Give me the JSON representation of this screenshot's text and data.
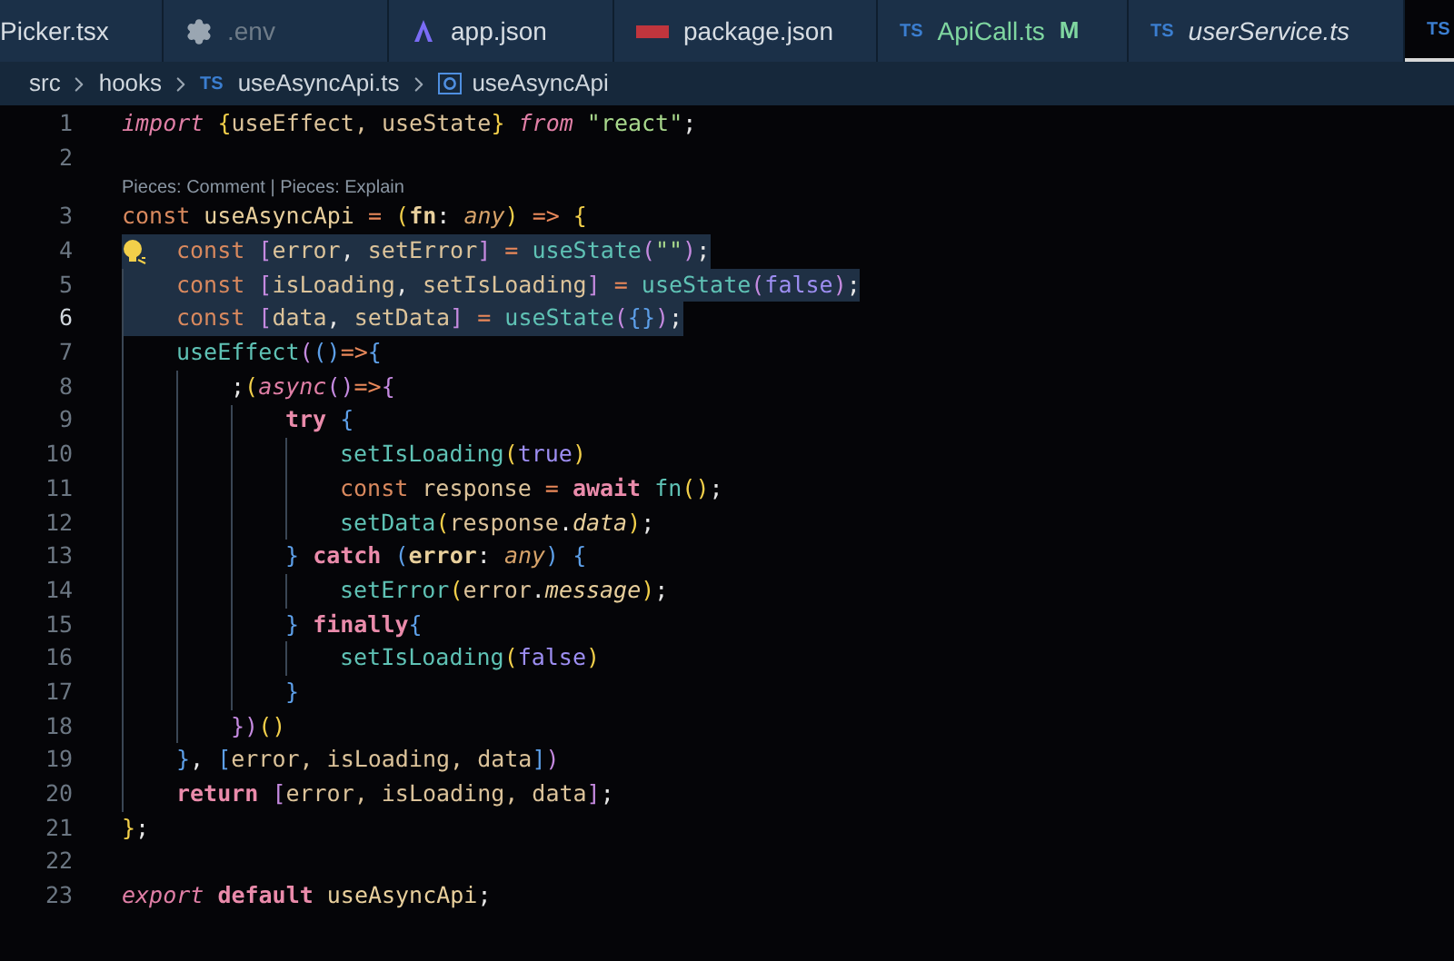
{
  "tabs": [
    {
      "label": "Picker.tsx",
      "kind": "plain",
      "selected": false,
      "italic": false,
      "dimmed": false
    },
    {
      "label": ".env",
      "kind": "config",
      "selected": false,
      "italic": false,
      "dimmed": true
    },
    {
      "label": "app.json",
      "kind": "app",
      "selected": false,
      "italic": false,
      "dimmed": false
    },
    {
      "label": "package.json",
      "kind": "npm",
      "selected": false,
      "italic": false,
      "dimmed": false
    },
    {
      "label": "ApiCall.ts",
      "kind": "ts",
      "badge": "TS",
      "selected": false,
      "italic": false,
      "dimmed": false,
      "modified": "M"
    },
    {
      "label": "userService.ts",
      "kind": "ts",
      "badge": "TS",
      "selected": false,
      "italic": true,
      "dimmed": false
    },
    {
      "kind": "ts",
      "badge": "TS",
      "selected": true
    }
  ],
  "breadcrumb": [
    {
      "kind": "folder",
      "label": "src"
    },
    {
      "kind": "folder",
      "label": "hooks"
    },
    {
      "kind": "file",
      "badge": "TS",
      "label": "useAsyncApi.ts"
    },
    {
      "kind": "symbol",
      "label": "useAsyncApi"
    }
  ],
  "lines": [
    {
      "number": "1",
      "selected": false,
      "active": false,
      "tokens": [
        {
          "kind": "kwi",
          "text": "import "
        },
        {
          "kind": "b1",
          "text": "{"
        },
        {
          "kind": "var",
          "text": "useEffect, useState"
        },
        {
          "kind": "b1",
          "text": "} "
        },
        {
          "kind": "kwi",
          "text": "from "
        },
        {
          "kind": "str",
          "text": "\"react\""
        },
        {
          "kind": "p",
          "text": ";"
        }
      ]
    },
    {
      "number": "2",
      "active": false
    },
    {
      "number": "3",
      "selected": false,
      "active": false,
      "codelens": "Pieces: Comment | Pieces: Explain",
      "tokens": [
        {
          "kind": "sto",
          "text": "const "
        },
        {
          "kind": "name",
          "text": "useAsyncApi "
        },
        {
          "kind": "op",
          "text": "= "
        },
        {
          "kind": "b1",
          "text": "("
        },
        {
          "kind": "param",
          "text": "fn"
        },
        {
          "kind": "p",
          "text": ": "
        },
        {
          "kind": "type",
          "text": "any"
        },
        {
          "kind": "b1",
          "text": ") "
        },
        {
          "kind": "op",
          "text": "=> "
        },
        {
          "kind": "b1",
          "text": "{"
        }
      ],
      "children": [
        {
          "number": "4",
          "selected": true,
          "active": false,
          "lightbulb": true,
          "tokens": [
            {
              "kind": "sto",
              "text": "const "
            },
            {
              "kind": "b2",
              "text": "["
            },
            {
              "kind": "var",
              "text": "error"
            },
            {
              "kind": "p",
              "text": ", "
            },
            {
              "kind": "var",
              "text": "setError"
            },
            {
              "kind": "b2",
              "text": "] "
            },
            {
              "kind": "op",
              "text": "= "
            },
            {
              "kind": "fn",
              "text": "useState"
            },
            {
              "kind": "b2",
              "text": "("
            },
            {
              "kind": "str",
              "text": "\"\""
            },
            {
              "kind": "b2",
              "text": ")"
            },
            {
              "kind": "p",
              "text": ";"
            }
          ]
        },
        {
          "number": "5",
          "selected": true,
          "active": false,
          "tokens": [
            {
              "kind": "sto",
              "text": "const "
            },
            {
              "kind": "b2",
              "text": "["
            },
            {
              "kind": "var",
              "text": "isLoading"
            },
            {
              "kind": "p",
              "text": ", "
            },
            {
              "kind": "var",
              "text": "setIsLoading"
            },
            {
              "kind": "b2",
              "text": "] "
            },
            {
              "kind": "op",
              "text": "= "
            },
            {
              "kind": "fn",
              "text": "useState"
            },
            {
              "kind": "b2",
              "text": "("
            },
            {
              "kind": "bool",
              "text": "false"
            },
            {
              "kind": "b2",
              "text": ")"
            },
            {
              "kind": "p",
              "text": ";"
            }
          ]
        },
        {
          "number": "6",
          "selected": true,
          "active": true,
          "tokens": [
            {
              "kind": "sto",
              "text": "const "
            },
            {
              "kind": "b2",
              "text": "["
            },
            {
              "kind": "var",
              "text": "data"
            },
            {
              "kind": "p",
              "text": ", "
            },
            {
              "kind": "var",
              "text": "setData"
            },
            {
              "kind": "b2",
              "text": "] "
            },
            {
              "kind": "op",
              "text": "= "
            },
            {
              "kind": "fn",
              "text": "useState"
            },
            {
              "kind": "b2",
              "text": "("
            },
            {
              "kind": "b3",
              "text": "{}"
            },
            {
              "kind": "b2",
              "text": ")"
            },
            {
              "kind": "p",
              "text": ";"
            }
          ]
        },
        {
          "number": "7",
          "selected": false,
          "active": false,
          "tokens": [
            {
              "kind": "fn",
              "text": "useEffect"
            },
            {
              "kind": "b2",
              "text": "("
            },
            {
              "kind": "b3",
              "text": "()"
            },
            {
              "kind": "op",
              "text": "=>"
            },
            {
              "kind": "b3",
              "text": "{"
            }
          ],
          "children": [
            {
              "number": "8",
              "selected": false,
              "active": false,
              "tokens": [
                {
                  "kind": "p",
                  "text": ";"
                },
                {
                  "kind": "b1",
                  "text": "("
                },
                {
                  "kind": "kwi",
                  "text": "async"
                },
                {
                  "kind": "b2",
                  "text": "()"
                },
                {
                  "kind": "op",
                  "text": "=>"
                },
                {
                  "kind": "b2",
                  "text": "{"
                }
              ],
              "children": [
                {
                  "number": "9",
                  "selected": false,
                  "active": false,
                  "tokens": [
                    {
                      "kind": "ctrl",
                      "text": "try "
                    },
                    {
                      "kind": "b3",
                      "text": "{"
                    }
                  ],
                  "children": [
                    {
                      "number": "10",
                      "selected": false,
                      "active": false,
                      "tokens": [
                        {
                          "kind": "fn",
                          "text": "setIsLoading"
                        },
                        {
                          "kind": "b1",
                          "text": "("
                        },
                        {
                          "kind": "bool",
                          "text": "true"
                        },
                        {
                          "kind": "b1",
                          "text": ")"
                        }
                      ]
                    },
                    {
                      "number": "11",
                      "selected": false,
                      "active": false,
                      "tokens": [
                        {
                          "kind": "sto",
                          "text": "const "
                        },
                        {
                          "kind": "var",
                          "text": "response "
                        },
                        {
                          "kind": "op",
                          "text": "= "
                        },
                        {
                          "kind": "ctrl",
                          "text": "await "
                        },
                        {
                          "kind": "fn",
                          "text": "fn"
                        },
                        {
                          "kind": "b1",
                          "text": "()"
                        },
                        {
                          "kind": "p",
                          "text": ";"
                        }
                      ]
                    },
                    {
                      "number": "12",
                      "selected": false,
                      "active": false,
                      "tokens": [
                        {
                          "kind": "fn",
                          "text": "setData"
                        },
                        {
                          "kind": "b1",
                          "text": "("
                        },
                        {
                          "kind": "var",
                          "text": "response"
                        },
                        {
                          "kind": "p",
                          "text": "."
                        },
                        {
                          "kind": "prop",
                          "text": "data"
                        },
                        {
                          "kind": "b1",
                          "text": ")"
                        },
                        {
                          "kind": "p",
                          "text": ";"
                        }
                      ]
                    }
                  ]
                },
                {
                  "number": "13",
                  "selected": false,
                  "active": false,
                  "tokens": [
                    {
                      "kind": "b3",
                      "text": "} "
                    },
                    {
                      "kind": "ctrl",
                      "text": "catch "
                    },
                    {
                      "kind": "b3",
                      "text": "("
                    },
                    {
                      "kind": "param",
                      "text": "error"
                    },
                    {
                      "kind": "p",
                      "text": ": "
                    },
                    {
                      "kind": "type",
                      "text": "any"
                    },
                    {
                      "kind": "b3",
                      "text": ") {"
                    }
                  ],
                  "children": [
                    {
                      "number": "14",
                      "selected": false,
                      "active": false,
                      "tokens": [
                        {
                          "kind": "fn",
                          "text": "setError"
                        },
                        {
                          "kind": "b1",
                          "text": "("
                        },
                        {
                          "kind": "var",
                          "text": "error"
                        },
                        {
                          "kind": "p",
                          "text": "."
                        },
                        {
                          "kind": "prop",
                          "text": "message"
                        },
                        {
                          "kind": "b1",
                          "text": ")"
                        },
                        {
                          "kind": "p",
                          "text": ";"
                        }
                      ]
                    }
                  ]
                },
                {
                  "number": "15",
                  "selected": false,
                  "active": false,
                  "tokens": [
                    {
                      "kind": "b3",
                      "text": "} "
                    },
                    {
                      "kind": "ctrl",
                      "text": "finally"
                    },
                    {
                      "kind": "b3",
                      "text": "{"
                    }
                  ],
                  "children": [
                    {
                      "number": "16",
                      "selected": false,
                      "active": false,
                      "tokens": [
                        {
                          "kind": "fn",
                          "text": "setIsLoading"
                        },
                        {
                          "kind": "b1",
                          "text": "("
                        },
                        {
                          "kind": "bool",
                          "text": "false"
                        },
                        {
                          "kind": "b1",
                          "text": ")"
                        }
                      ]
                    }
                  ]
                },
                {
                  "number": "17",
                  "selected": false,
                  "active": false,
                  "tokens": [
                    {
                      "kind": "b3",
                      "text": "}"
                    }
                  ]
                }
              ]
            },
            {
              "number": "18",
              "selected": false,
              "active": false,
              "tokens": [
                {
                  "kind": "b2",
                  "text": "})"
                },
                {
                  "kind": "b1",
                  "text": "()"
                }
              ]
            }
          ]
        },
        {
          "number": "19",
          "selected": false,
          "active": false,
          "tokens": [
            {
              "kind": "b3",
              "text": "}"
            },
            {
              "kind": "p",
              "text": ", "
            },
            {
              "kind": "b3",
              "text": "["
            },
            {
              "kind": "var",
              "text": "error, isLoading, data"
            },
            {
              "kind": "b3",
              "text": "]"
            },
            {
              "kind": "b2",
              "text": ")"
            }
          ]
        },
        {
          "number": "20",
          "selected": false,
          "active": false,
          "tokens": [
            {
              "kind": "ctrl",
              "text": "return "
            },
            {
              "kind": "b2",
              "text": "["
            },
            {
              "kind": "var",
              "text": "error, isLoading, data"
            },
            {
              "kind": "b2",
              "text": "]"
            },
            {
              "kind": "p",
              "text": ";"
            }
          ]
        }
      ]
    },
    {
      "number": "21",
      "selected": false,
      "active": false,
      "tokens": [
        {
          "kind": "b1",
          "text": "}"
        },
        {
          "kind": "p",
          "text": ";"
        }
      ]
    },
    {
      "number": "22",
      "active": false
    },
    {
      "number": "23",
      "selected": false,
      "active": false,
      "tokens": [
        {
          "kind": "kwi",
          "text": "export "
        },
        {
          "kind": "ctrl",
          "text": "default "
        },
        {
          "kind": "name",
          "text": "useAsyncApi"
        },
        {
          "kind": "p",
          "text": ";"
        }
      ]
    }
  ]
}
